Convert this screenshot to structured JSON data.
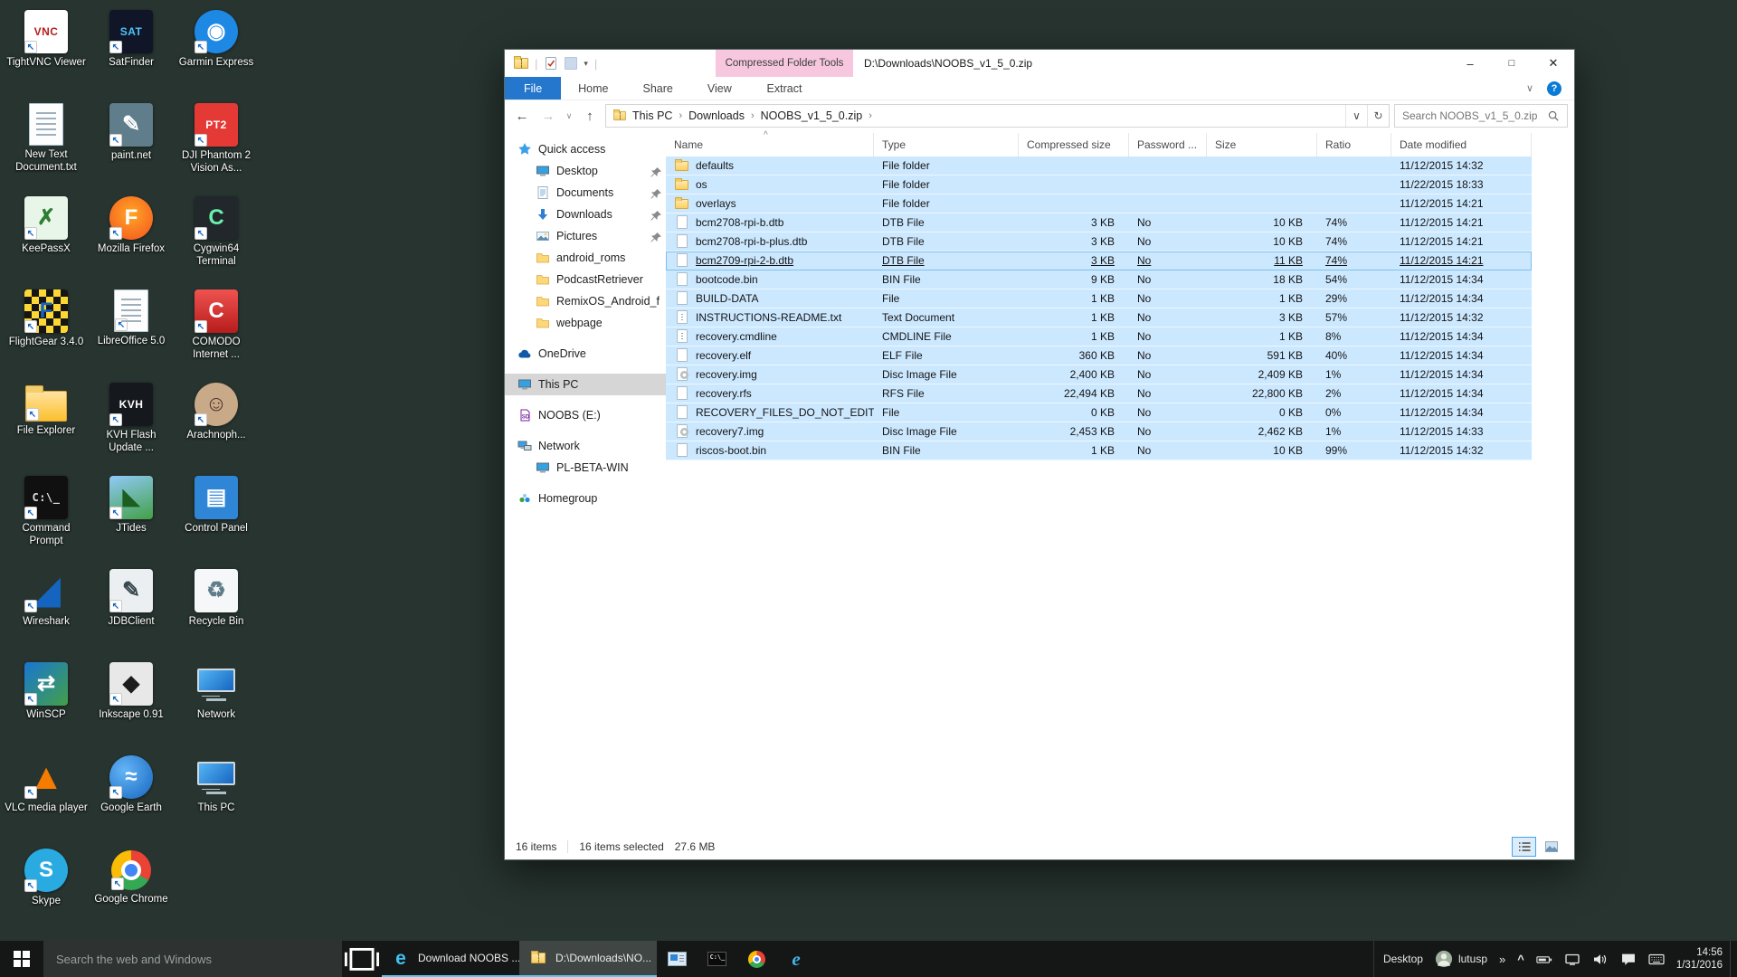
{
  "desktop": {
    "icons": [
      {
        "label": "TightVNC Viewer",
        "name": "tightvnc-viewer",
        "glyph": "VNC",
        "fg": "#b71c1c",
        "bg": "#ffffff",
        "shape": "square",
        "small": true,
        "arrow": true
      },
      {
        "label": "SatFinder",
        "name": "satfinder",
        "glyph": "SAT",
        "fg": "#4fc3f7",
        "bg": "#101528",
        "shape": "square",
        "small": true,
        "arrow": true
      },
      {
        "label": "Garmin Express",
        "name": "garmin-express",
        "glyph": "◉",
        "fg": "#ffffff",
        "bg": "#1e88e5",
        "shape": "circle",
        "arrow": true
      },
      {
        "label": "New Text Document.txt",
        "name": "new-text-document",
        "shape": "page",
        "arrow": false
      },
      {
        "label": "paint.net",
        "name": "paint-net",
        "glyph": "✎",
        "fg": "#ffffff",
        "bg": "#607d8b",
        "shape": "square",
        "arrow": true
      },
      {
        "label": "DJI Phantom 2 Vision As...",
        "name": "dji-phantom-2-vision",
        "glyph": "PT2",
        "fg": "#ffffff",
        "bg": "#e53935",
        "shape": "square",
        "small": true,
        "arrow": true
      },
      {
        "label": "KeePassX",
        "name": "keepassx",
        "glyph": "✗",
        "fg": "#2e7d32",
        "bg": "#e8f5e9",
        "shape": "square",
        "arrow": true
      },
      {
        "label": "Mozilla Firefox",
        "name": "mozilla-firefox",
        "glyph": "F",
        "fg": "#ffffff",
        "bg": "radial-gradient(circle at 50% 40%, #ffa726, #f4511e)",
        "shape": "circle",
        "arrow": true
      },
      {
        "label": "Cygwin64 Terminal",
        "name": "cygwin64-terminal",
        "glyph": "C",
        "fg": "#69f0ae",
        "bg": "#21272b",
        "shape": "square",
        "arrow": true
      },
      {
        "label": "FlightGear 3.4.0",
        "name": "flightgear",
        "glyph": "F",
        "fg": "#1565c0",
        "bg": "repeating-conic-gradient(#151515 0% 25%, #fdd835 0% 50%)",
        "bgsize": "16px 16px",
        "shape": "square",
        "arrow": true
      },
      {
        "label": "LibreOffice 5.0",
        "name": "libreoffice",
        "shape": "page",
        "arrow": true
      },
      {
        "label": "COMODO Internet ...",
        "name": "comodo-internet-security",
        "glyph": "C",
        "fg": "#ffffff",
        "bg": "linear-gradient(#ef5350,#b71c1c)",
        "shape": "square",
        "arrow": true
      },
      {
        "label": "File Explorer",
        "name": "file-explorer",
        "shape": "folder",
        "arrow": true
      },
      {
        "label": "KVH Flash Update ...",
        "name": "kvh-flash-update",
        "glyph": "KVH",
        "fg": "#ffffff",
        "bg": "#15181c",
        "shape": "square",
        "small": true,
        "arrow": true
      },
      {
        "label": "Arachnoph...",
        "name": "arachnophilia",
        "glyph": "☺",
        "fg": "#4e342e",
        "bg": "#c8a988",
        "shape": "circle",
        "arrow": true
      },
      {
        "label": "Command Prompt",
        "name": "command-prompt",
        "glyph": "C:\\_",
        "fg": "#e0e0e0",
        "bg": "#101010",
        "shape": "square",
        "small": true,
        "mono": true,
        "arrow": true
      },
      {
        "label": "JTides",
        "name": "jtides",
        "glyph": "◣",
        "fg": "#1b5e20",
        "bg": "linear-gradient(160deg,#90caf9,#43a047)",
        "shape": "square",
        "arrow": true
      },
      {
        "label": "Control Panel",
        "name": "control-panel",
        "glyph": "▤",
        "fg": "#ffffff",
        "bg": "#2f86d6",
        "shape": "square",
        "arrow": false
      },
      {
        "label": "Wireshark",
        "name": "wireshark",
        "glyph": "◢",
        "fg": "#1565c0",
        "bg": "transparent",
        "shape": "plain",
        "arrow": true
      },
      {
        "label": "JDBClient",
        "name": "jdbclient",
        "glyph": "✎",
        "fg": "#37474f",
        "bg": "#eceff1",
        "shape": "square",
        "arrow": true
      },
      {
        "label": "Recycle Bin",
        "name": "recycle-bin",
        "glyph": "♻",
        "fg": "#607d8b",
        "bg": "#f5f7f8",
        "shape": "square",
        "arrow": false
      },
      {
        "label": "WinSCP",
        "name": "winscp",
        "glyph": "⇄",
        "fg": "#ffffff",
        "bg": "linear-gradient(135deg,#1976d2,#43a047)",
        "shape": "square",
        "arrow": true
      },
      {
        "label": "Inkscape 0.91",
        "name": "inkscape",
        "glyph": "◆",
        "fg": "#1c1c1c",
        "bg": "#e8e8e8",
        "shape": "square",
        "arrow": true
      },
      {
        "label": "Network",
        "name": "network",
        "shape": "monitor",
        "arrow": false
      },
      {
        "label": "VLC media player",
        "name": "vlc-media-player",
        "glyph": "▲",
        "fg": "#f57c00",
        "bg": "transparent",
        "shape": "plain",
        "arrow": true
      },
      {
        "label": "Google Earth",
        "name": "google-earth",
        "glyph": "≈",
        "fg": "#ffffff",
        "bg": "radial-gradient(circle at 35% 35%, #64b5f6, #1565c0)",
        "shape": "circle",
        "arrow": true
      },
      {
        "label": "This PC",
        "name": "this-pc",
        "shape": "monitor",
        "arrow": false
      },
      {
        "label": "Skype",
        "name": "skype",
        "glyph": "S",
        "fg": "#ffffff",
        "bg": "#29abe2",
        "shape": "circle",
        "arrow": true
      },
      {
        "label": "Google Chrome",
        "name": "google-chrome",
        "shape": "chrome",
        "arrow": true
      }
    ]
  },
  "win": {
    "title": "D:\\Downloads\\NOOBS_v1_5_0.zip",
    "contextual_group": "Compressed Folder Tools",
    "ribbon": {
      "tabs": [
        "File",
        "Home",
        "Share",
        "View"
      ],
      "extract_tab": "Extract"
    },
    "breadcrumb": [
      "This PC",
      "Downloads",
      "NOOBS_v1_5_0.zip"
    ],
    "search_placeholder": "Search NOOBS_v1_5_0.zip",
    "sidebar": [
      {
        "label": "Quick access",
        "icon": "star",
        "indent": 0,
        "gap": false
      },
      {
        "label": "Desktop",
        "icon": "monitor",
        "indent": 1,
        "pinned": true
      },
      {
        "label": "Documents",
        "icon": "doc",
        "indent": 1,
        "pinned": true
      },
      {
        "label": "Downloads",
        "icon": "download",
        "indent": 1,
        "pinned": true
      },
      {
        "label": "Pictures",
        "icon": "pictures",
        "indent": 1,
        "pinned": true
      },
      {
        "label": "android_roms",
        "icon": "folder",
        "indent": 1
      },
      {
        "label": "PodcastRetriever",
        "icon": "folder",
        "indent": 1
      },
      {
        "label": "RemixOS_Android_f",
        "icon": "folder",
        "indent": 1
      },
      {
        "label": "webpage",
        "icon": "folder",
        "indent": 1
      },
      {
        "label": "OneDrive",
        "icon": "cloud",
        "indent": 0,
        "gap": true
      },
      {
        "label": "This PC",
        "icon": "monitor",
        "indent": 0,
        "gap": true,
        "selected": true
      },
      {
        "label": "NOOBS (E:)",
        "icon": "sdcard",
        "indent": 0,
        "gap": true
      },
      {
        "label": "Network",
        "icon": "network",
        "indent": 0,
        "gap": true
      },
      {
        "label": "PL-BETA-WIN",
        "icon": "monitor",
        "indent": 1
      },
      {
        "label": "Homegroup",
        "icon": "homegroup",
        "indent": 0,
        "gap": true
      }
    ],
    "list": {
      "columns": [
        "Name",
        "Type",
        "Compressed size",
        "Password ...",
        "Size",
        "Ratio",
        "Date modified"
      ],
      "sort_caret": "^",
      "files": [
        {
          "name": "defaults",
          "type": "File folder",
          "compressed": "",
          "password": "",
          "size": "",
          "ratio": "",
          "modified": "11/12/2015 14:32",
          "icon": "folder"
        },
        {
          "name": "os",
          "type": "File folder",
          "compressed": "",
          "password": "",
          "size": "",
          "ratio": "",
          "modified": "11/22/2015 18:33",
          "icon": "folder"
        },
        {
          "name": "overlays",
          "type": "File folder",
          "compressed": "",
          "password": "",
          "size": "",
          "ratio": "",
          "modified": "11/12/2015 14:21",
          "icon": "folder"
        },
        {
          "name": "bcm2708-rpi-b.dtb",
          "type": "DTB File",
          "compressed": "3 KB",
          "password": "No",
          "size": "10 KB",
          "ratio": "74%",
          "modified": "11/12/2015 14:21",
          "icon": "file"
        },
        {
          "name": "bcm2708-rpi-b-plus.dtb",
          "type": "DTB File",
          "compressed": "3 KB",
          "password": "No",
          "size": "10 KB",
          "ratio": "74%",
          "modified": "11/12/2015 14:21",
          "icon": "file"
        },
        {
          "name": "bcm2709-rpi-2-b.dtb",
          "type": "DTB File",
          "compressed": "3 KB",
          "password": "No",
          "size": "11 KB",
          "ratio": "74%",
          "modified": "11/12/2015 14:21",
          "icon": "file",
          "hover": true
        },
        {
          "name": "bootcode.bin",
          "type": "BIN File",
          "compressed": "9 KB",
          "password": "No",
          "size": "18 KB",
          "ratio": "54%",
          "modified": "11/12/2015 14:34",
          "icon": "file"
        },
        {
          "name": "BUILD-DATA",
          "type": "File",
          "compressed": "1 KB",
          "password": "No",
          "size": "1 KB",
          "ratio": "29%",
          "modified": "11/12/2015 14:34",
          "icon": "file"
        },
        {
          "name": "INSTRUCTIONS-README.txt",
          "type": "Text Document",
          "compressed": "1 KB",
          "password": "No",
          "size": "3 KB",
          "ratio": "57%",
          "modified": "11/12/2015 14:32",
          "icon": "textdoc"
        },
        {
          "name": "recovery.cmdline",
          "type": "CMDLINE File",
          "compressed": "1 KB",
          "password": "No",
          "size": "1 KB",
          "ratio": "8%",
          "modified": "11/12/2015 14:34",
          "icon": "cmdline"
        },
        {
          "name": "recovery.elf",
          "type": "ELF File",
          "compressed": "360 KB",
          "password": "No",
          "size": "591 KB",
          "ratio": "40%",
          "modified": "11/12/2015 14:34",
          "icon": "file"
        },
        {
          "name": "recovery.img",
          "type": "Disc Image File",
          "compressed": "2,400 KB",
          "password": "No",
          "size": "2,409 KB",
          "ratio": "1%",
          "modified": "11/12/2015 14:34",
          "icon": "disc"
        },
        {
          "name": "recovery.rfs",
          "type": "RFS File",
          "compressed": "22,494 KB",
          "password": "No",
          "size": "22,800 KB",
          "ratio": "2%",
          "modified": "11/12/2015 14:34",
          "icon": "file"
        },
        {
          "name": "RECOVERY_FILES_DO_NOT_EDIT",
          "type": "File",
          "compressed": "0 KB",
          "password": "No",
          "size": "0 KB",
          "ratio": "0%",
          "modified": "11/12/2015 14:34",
          "icon": "file"
        },
        {
          "name": "recovery7.img",
          "type": "Disc Image File",
          "compressed": "2,453 KB",
          "password": "No",
          "size": "2,462 KB",
          "ratio": "1%",
          "modified": "11/12/2015 14:33",
          "icon": "disc"
        },
        {
          "name": "riscos-boot.bin",
          "type": "BIN File",
          "compressed": "1 KB",
          "password": "No",
          "size": "10 KB",
          "ratio": "99%",
          "modified": "11/12/2015 14:32",
          "icon": "file"
        }
      ]
    },
    "status": {
      "items": "16 items",
      "selected": "16 items selected",
      "size": "27.6 MB"
    }
  },
  "taskbar": {
    "search_placeholder": "Search the web and Windows",
    "buttons": [
      {
        "label": "Download NOOBS ...",
        "icon": "edge",
        "name": "edge-download-noobs",
        "active": false
      },
      {
        "label": "D:\\Downloads\\NO...",
        "icon": "zip",
        "name": "explorer-zip-window",
        "active": true
      }
    ],
    "pinned": [
      {
        "name": "control-panel",
        "icon": "cpl"
      },
      {
        "name": "command-prompt",
        "icon": "cmd"
      },
      {
        "name": "chrome",
        "icon": "chrome"
      },
      {
        "name": "internet-explorer",
        "icon": "ie"
      }
    ],
    "tray": {
      "desktop_label": "Desktop",
      "user": "lutusp",
      "overflow_chevron": "»",
      "hidden_icons_chevron": "^",
      "icons": [
        {
          "name": "battery-icon",
          "key": "battery"
        },
        {
          "name": "network-icon",
          "key": "nettray"
        },
        {
          "name": "volume-icon",
          "key": "volume"
        },
        {
          "name": "action-center-icon",
          "key": "chat"
        },
        {
          "name": "keyboard-icon",
          "key": "keyboard"
        }
      ],
      "time": "14:56",
      "date": "1/31/2016"
    }
  }
}
